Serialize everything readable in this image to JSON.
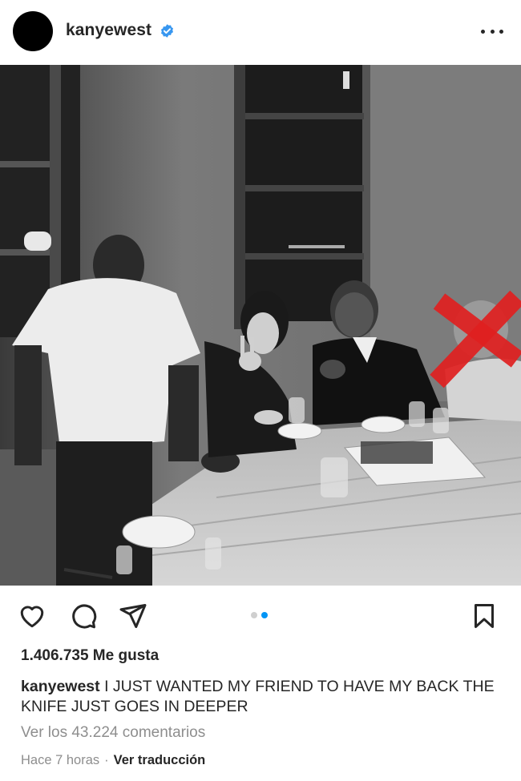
{
  "post": {
    "username": "kanyewest",
    "verified": true,
    "more_icon": "more-horizontal-icon",
    "photo": {
      "description_icon": "dinner-photo",
      "carousel_total": 2,
      "carousel_active": 2
    },
    "actions": {
      "like_icon": "heart-icon",
      "comment_icon": "comment-icon",
      "share_icon": "paper-plane-icon",
      "save_icon": "bookmark-icon"
    },
    "likes_text": "1.406.735 Me gusta",
    "caption": {
      "username": "kanyewest",
      "text": "I JUST WANTED MY FRIEND TO HAVE MY BACK  THE KNIFE JUST GOES IN DEEPER"
    },
    "comments_link": "Ver los 43.224 comentarios",
    "time": "Hace 7 horas",
    "separator": "·",
    "translate": "Ver traducción",
    "colors": {
      "verified": "#3897f0",
      "active_dot": "#0095f6",
      "x_mark": "#e02020"
    }
  }
}
